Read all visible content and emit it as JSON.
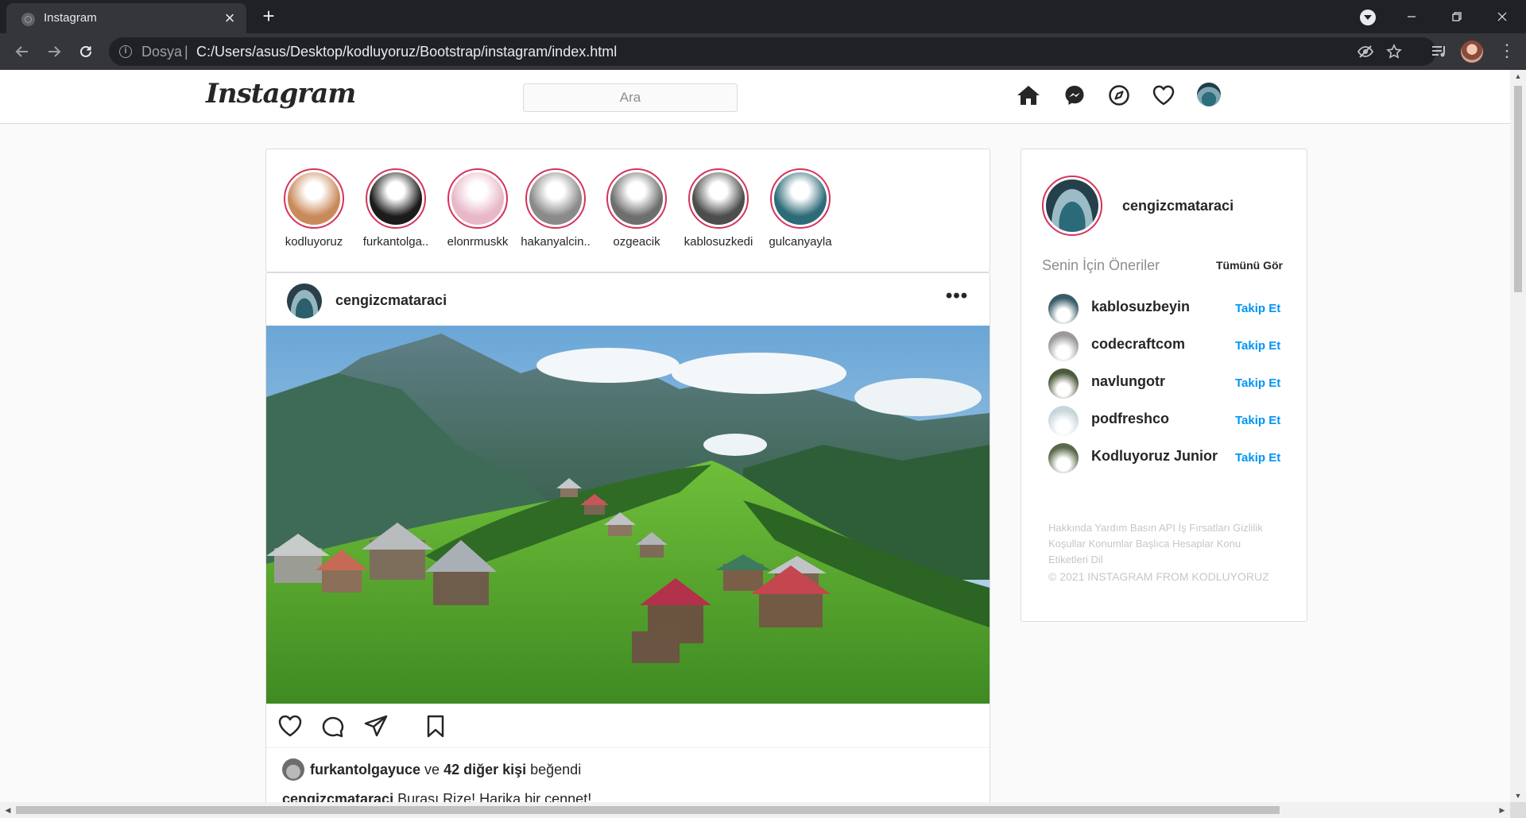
{
  "browser": {
    "tab_title": "Instagram",
    "scheme_label": "Dosya",
    "url": "C:/Users/asus/Desktop/kodluyoruz/Bootstrap/instagram/index.html"
  },
  "header": {
    "logo": "Instagram",
    "search_placeholder": "Ara",
    "nav_icons": [
      "home-icon",
      "messenger-icon",
      "explore-icon",
      "heart-icon",
      "profile-avatar"
    ]
  },
  "stories": [
    {
      "name": "kodluyoruz",
      "color": "#c98a5a"
    },
    {
      "name": "furkantolga..",
      "color": "#1b1b1b"
    },
    {
      "name": "elonrmuskk",
      "color": "#e8b8c8"
    },
    {
      "name": "hakanyalcin..",
      "color": "#8a8a8a"
    },
    {
      "name": "ozgeacik",
      "color": "#6e6e6e"
    },
    {
      "name": "kablosuzkedi",
      "color": "#4d4d4d"
    },
    {
      "name": "gulcanyayla",
      "color": "#2d6b78"
    }
  ],
  "post": {
    "username": "cengizcmataraci",
    "more_label": "•••",
    "likes": {
      "user": "furkantolgayuce",
      "connector": "ve",
      "others": "42 diğer kişi",
      "suffix": "beğendi"
    },
    "caption": {
      "user": "cengizcmataraci",
      "text": "Burası Rize! Harika bir cennet!"
    }
  },
  "sidebar": {
    "username": "cengizcmataraci",
    "suggestions_title": "Senin İçin Öneriler",
    "see_all": "Tümünü Gör",
    "follow_label": "Takip Et",
    "suggestions": [
      {
        "name": "kablosuzbeyin",
        "color": "#3a5c6a"
      },
      {
        "name": "codecraftcom",
        "color": "#9a9a9a"
      },
      {
        "name": "navlungotr",
        "color": "#4a5a3a"
      },
      {
        "name": "podfreshco",
        "color": "#c8d6dc"
      },
      {
        "name": "Kodluyoruz Junior",
        "color": "#5a6a4a"
      }
    ],
    "footer_links": "Hakkında Yardım Basın API İş Fırsatları Gizlilik Koşullar Konumlar Başlıca Hesaplar Konu Etiketleri Dil",
    "copyright": "© 2021 INSTAGRAM FROM KODLUYORUZ"
  },
  "colors": {
    "story_ring": "#d6335c",
    "follow_blue": "#0095f6",
    "chrome_dark": "#202124"
  }
}
